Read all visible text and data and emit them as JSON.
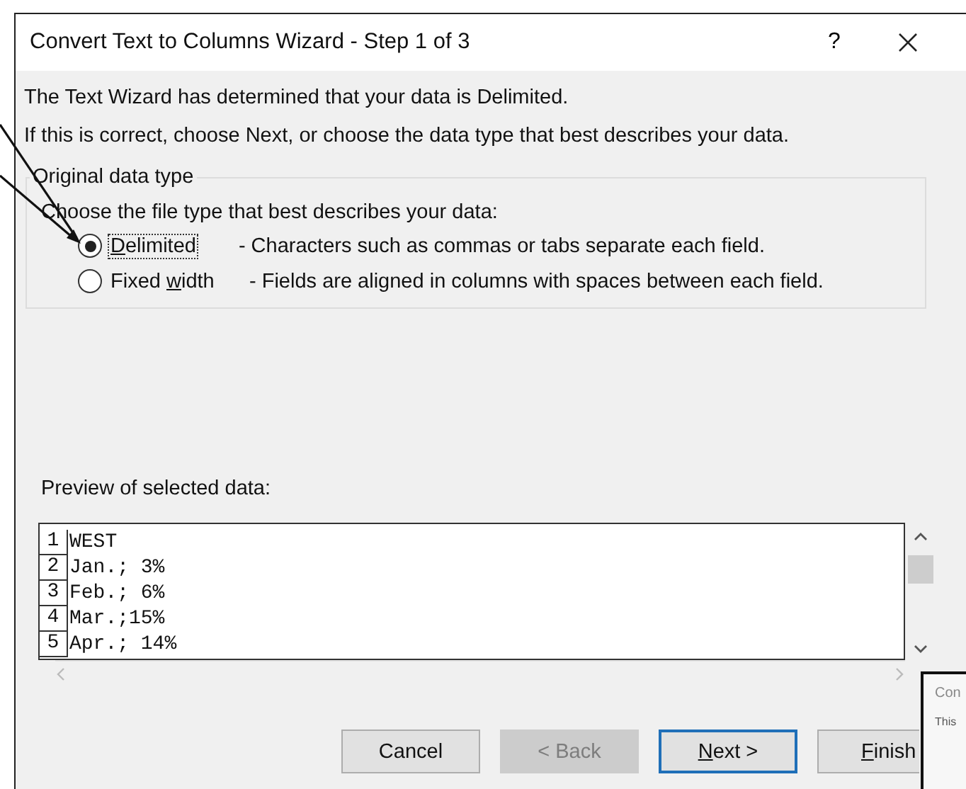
{
  "window": {
    "title": "Convert Text to Columns Wizard - Step 1 of 3",
    "help": "?"
  },
  "intro": [
    "The Text Wizard has determined that your data is Delimited.",
    "If this is correct, choose Next, or choose the data type that best describes your data."
  ],
  "group": {
    "legend": "Original data type",
    "prompt": "Choose the file type that best describes your data:",
    "options": [
      {
        "label_parts": [
          {
            "text": "D",
            "underline": true
          },
          {
            "text": "elimited",
            "underline": false
          }
        ],
        "description": "- Characters such as commas or tabs separate each field.",
        "selected": true
      },
      {
        "label_parts": [
          {
            "text": "Fixed ",
            "underline": false
          },
          {
            "text": "w",
            "underline": true
          },
          {
            "text": "idth",
            "underline": false
          }
        ],
        "description": "- Fields are aligned in columns with spaces between each field.",
        "selected": false
      }
    ]
  },
  "preview": {
    "label": "Preview of selected data:",
    "rows": [
      {
        "number": "1",
        "text": "WEST"
      },
      {
        "number": "2",
        "text": "Jan.; 3%"
      },
      {
        "number": "3",
        "text": "Feb.; 6%"
      },
      {
        "number": "4",
        "text": "Mar.;15%"
      },
      {
        "number": "5",
        "text": "Apr.; 14%"
      }
    ]
  },
  "buttons": [
    {
      "label_parts": [
        {
          "text": "Cancel",
          "underline": false
        }
      ],
      "disabled": false,
      "focused": false
    },
    {
      "label_parts": [
        {
          "text": "< Back",
          "underline": false
        }
      ],
      "disabled": true,
      "focused": false
    },
    {
      "label_parts": [
        {
          "text": "N",
          "underline": true
        },
        {
          "text": "ext >",
          "underline": false
        }
      ],
      "disabled": false,
      "focused": true
    },
    {
      "label_parts": [
        {
          "text": "F",
          "underline": true
        },
        {
          "text": "inish",
          "underline": false
        }
      ],
      "disabled": false,
      "focused": false
    }
  ],
  "background_window": {
    "title": "Con",
    "text": "This"
  }
}
